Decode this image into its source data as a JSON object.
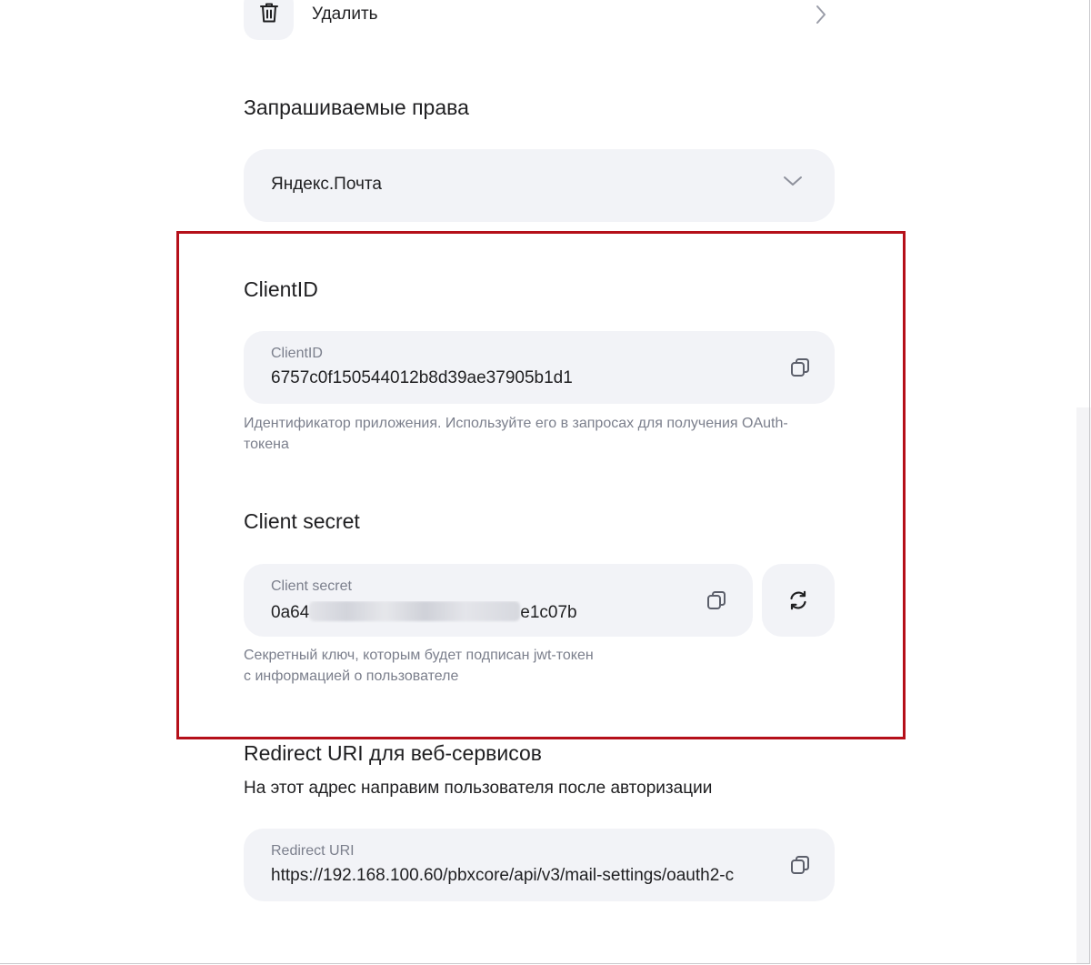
{
  "delete": {
    "label": "Удалить"
  },
  "permissions": {
    "title": "Запрашиваемые права",
    "selected": "Яндекс.Почта"
  },
  "client_id": {
    "title": "ClientID",
    "field_label": "ClientID",
    "value": "6757c0f150544012b8d39ae37905b1d1",
    "hint": "Идентификатор приложения. Используйте его в запросах для получения OAuth-токена"
  },
  "client_secret": {
    "title": "Client secret",
    "field_label": "Client secret",
    "value_prefix": "0a64",
    "value_suffix": "e1c07b",
    "hint_line1": "Секретный ключ, которым будет подписан jwt-токен",
    "hint_line2": "с информацией о пользователе"
  },
  "redirect": {
    "title": "Redirect URI для веб-сервисов",
    "subtitle": "На этот адрес направим пользователя после авторизации",
    "field_label": "Redirect URI",
    "value": "https://192.168.100.60/pbxcore/api/v3/mail-settings/oauth2-c"
  },
  "colors": {
    "accent_highlight": "#b5101a",
    "field_bg": "#f2f3f7",
    "hint_text": "#7b7f8c"
  },
  "icons": [
    "trash-icon",
    "chevron-right-icon",
    "chevron-down-icon",
    "copy-icon",
    "refresh-icon"
  ]
}
